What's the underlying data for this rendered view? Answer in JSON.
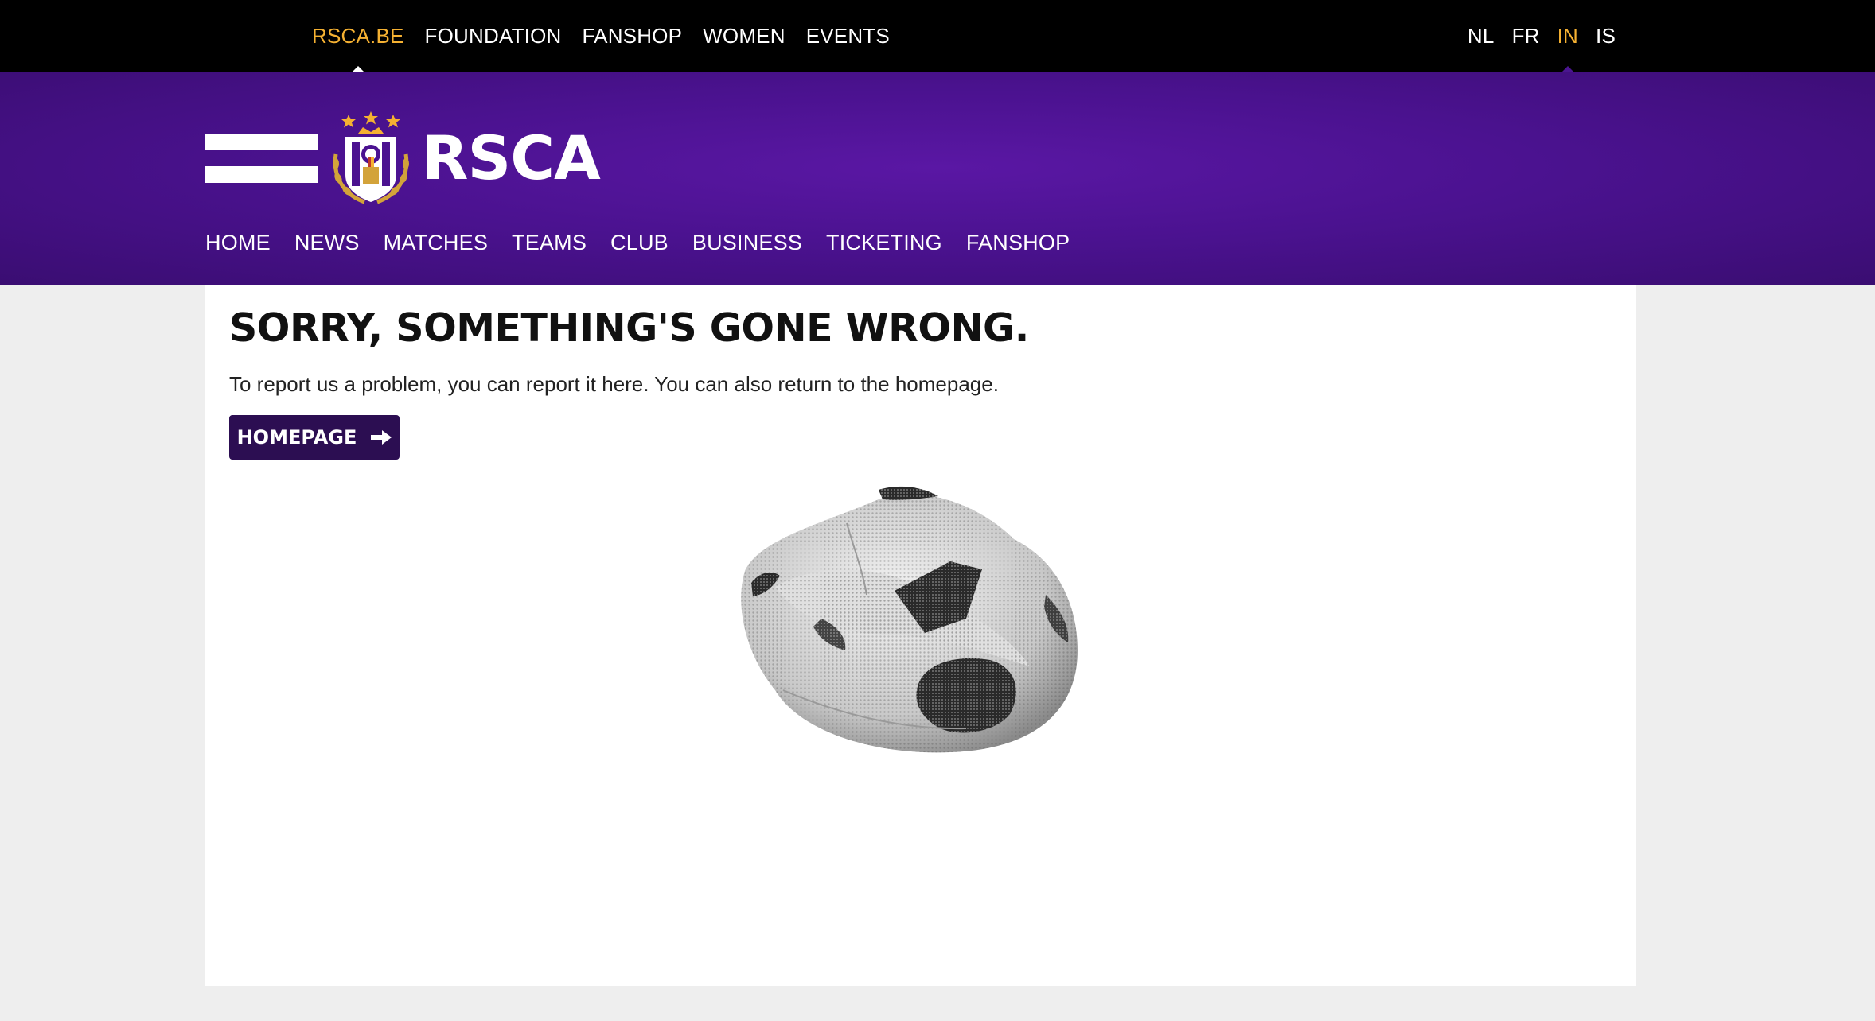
{
  "top_nav": {
    "links": [
      {
        "label": "RSCA.BE",
        "active": true
      },
      {
        "label": "FOUNDATION",
        "active": false
      },
      {
        "label": "FANSHOP",
        "active": false
      },
      {
        "label": "WOMEN",
        "active": false
      },
      {
        "label": "EVENTS",
        "active": false
      }
    ],
    "languages": [
      {
        "label": "NL",
        "active": false
      },
      {
        "label": "FR",
        "active": false
      },
      {
        "label": "IN",
        "active": true
      },
      {
        "label": "IS",
        "active": false
      }
    ]
  },
  "header": {
    "logo_text": "RSCA",
    "main_nav": [
      "HOME",
      "NEWS",
      "MATCHES",
      "TEAMS",
      "CLUB",
      "BUSINESS",
      "TICKETING",
      "FANSHOP"
    ]
  },
  "content": {
    "title": "SORRY, SOMETHING'S GONE WRONG.",
    "text": "To report us a problem, you can report it here. You can also return to the homepage.",
    "button_label": "HOMEPAGE"
  },
  "colors": {
    "active_gold": "#f5b132",
    "brand_purple": "#4b1290",
    "button_purple": "#2c0e52",
    "top_bar": "#000000"
  },
  "icons": {
    "button": "arrow-right-icon",
    "logo": "rsca-crest-icon",
    "illustration": "deflated-football-icon"
  }
}
